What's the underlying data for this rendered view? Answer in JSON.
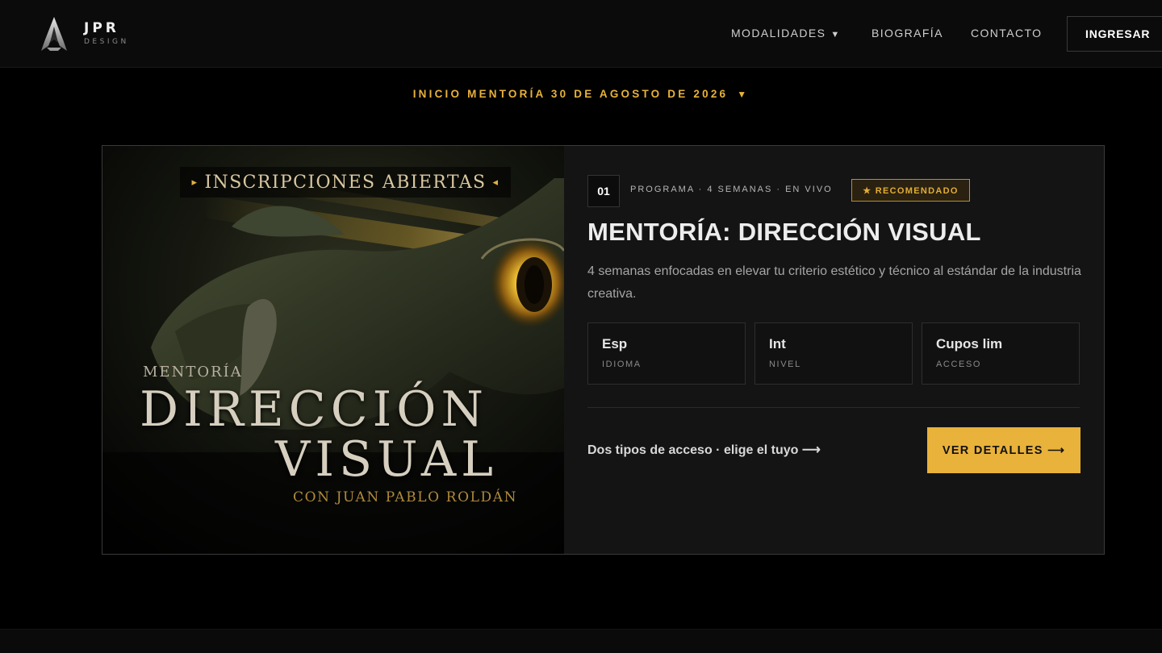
{
  "header": {
    "logo": {
      "main": "JPR",
      "sub": "DESIGN",
      "icon": "jpr-emblem-icon"
    },
    "nav": {
      "modalidades": "MODALIDADES",
      "modalidades_caret": "▼",
      "biografia": "BIOGRAFÍA",
      "contacto": "CONTACTO"
    },
    "login_label": "INGRESAR"
  },
  "announcement": {
    "text": "INICIO MENTORÍA 30 DE AGOSTO DE 2026",
    "caret": "▼"
  },
  "card": {
    "poster": {
      "banner": "INSCRIPCIONES ABIERTAS",
      "banner_left_arrow": "▸",
      "banner_right_arrow": "◂",
      "kicker": "MENTORÍA",
      "title_line1": "DIRECCIÓN",
      "title_line2": "VISUAL",
      "byline": "CON JUAN PABLO ROLDÁN"
    },
    "number": "01",
    "meta": "PROGRAMA · 4 SEMANAS · EN VIVO",
    "badge": "★ RECOMENDADO",
    "title": "MENTORÍA: DIRECCIÓN VISUAL",
    "description": "4 semanas enfocadas en elevar tu criterio estético y técnico al estándar de la industria creativa.",
    "stats": [
      {
        "value": "Esp",
        "label": "IDIOMA"
      },
      {
        "value": "Int",
        "label": "NIVEL"
      },
      {
        "value": "Cupos lim",
        "label": "ACCESO"
      }
    ],
    "access_text": "Dos tipos de acceso · elige el tuyo ⟶",
    "cta_label": "VER DETALLES ⟶"
  },
  "colors": {
    "accent": "#e9b23a",
    "background": "#000000",
    "card_bg": "#141414"
  }
}
